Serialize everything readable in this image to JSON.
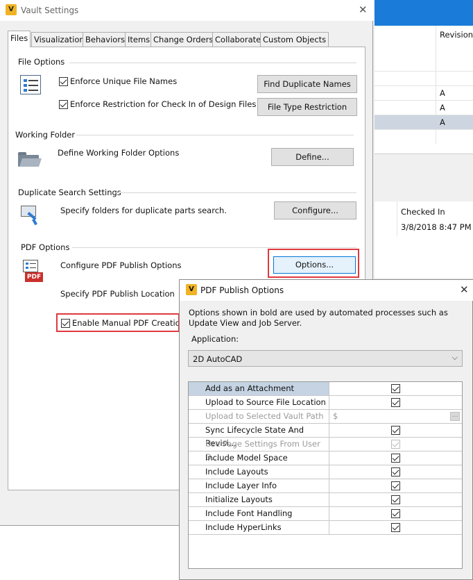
{
  "vault": {
    "title": "Vault Settings",
    "app_icon_letter": "V",
    "tabs": [
      "Files",
      "Visualization",
      "Behaviors",
      "Items",
      "Change Orders",
      "Collaborate",
      "Custom Objects"
    ],
    "file_options": {
      "header": "File Options",
      "opt1": "Enforce Unique File Names",
      "opt2": "Enforce Restriction for Check In of Design Files",
      "btn1": "Find Duplicate Names",
      "btn2": "File Type Restriction"
    },
    "working_folder": {
      "header": "Working Folder",
      "desc": "Define Working Folder Options",
      "btn": "Define..."
    },
    "dup_search": {
      "header": "Duplicate Search Settings",
      "desc": "Specify folders for duplicate parts search.",
      "btn": "Configure..."
    },
    "pdf": {
      "header": "PDF Options",
      "desc1": "Configure PDF Publish Options",
      "btn": "Options...",
      "desc2": "Specify PDF Publish Location",
      "check": "Enable Manual PDF Creation",
      "icon_text": "PDF"
    }
  },
  "background": {
    "revision_header": "Revision",
    "revision_values": [
      "A",
      "A",
      "A"
    ],
    "checked_in_header": "Checked In",
    "checked_in_value": "3/8/2018 8:47 PM"
  },
  "pdf_dialog": {
    "title": "PDF Publish Options",
    "info": "Options shown in bold are used by automated processes such as Update View and Job Server.",
    "app_label": "Application:",
    "app_value": "2D AutoCAD",
    "path_value": "$",
    "rows": [
      {
        "name": "Add as an Attachment",
        "checked": true,
        "disabled": false,
        "selected": true
      },
      {
        "name": "Upload to Source File Location",
        "checked": true,
        "disabled": false
      },
      {
        "name": "Upload to Selected Vault Path",
        "checked": false,
        "disabled": true,
        "path": true
      },
      {
        "name": "Sync Lifecycle State And Revisi...",
        "checked": true,
        "disabled": false
      },
      {
        "name": "Use Page Settings From User D...",
        "checked": true,
        "disabled": true
      },
      {
        "name": "Include Model Space",
        "checked": true,
        "disabled": false
      },
      {
        "name": "Include Layouts",
        "checked": true,
        "disabled": false
      },
      {
        "name": "Include Layer Info",
        "checked": true,
        "disabled": false
      },
      {
        "name": "Initialize Layouts",
        "checked": true,
        "disabled": false
      },
      {
        "name": "Include Font Handling",
        "checked": true,
        "disabled": false
      },
      {
        "name": "Include HyperLinks",
        "checked": true,
        "disabled": false
      }
    ]
  },
  "colors": {
    "accent_red": "#e0393e",
    "titlebar_blue": "#1a7cd8",
    "selected_row": "#c5d3e3",
    "vault_icon": "#f0b323"
  }
}
